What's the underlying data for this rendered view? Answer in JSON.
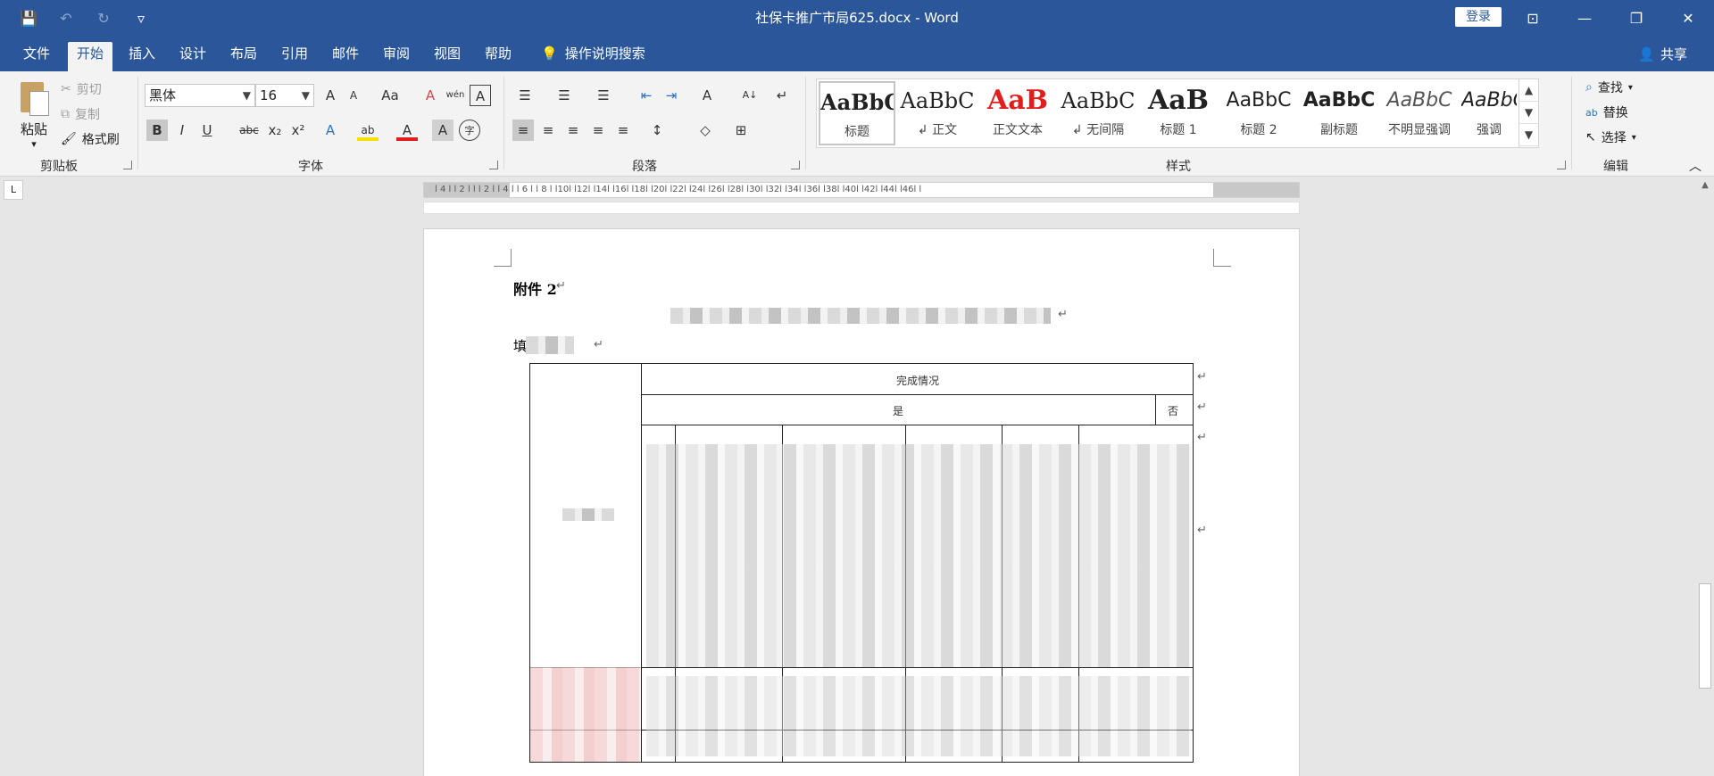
{
  "titlebar": {
    "title": "社保卡推广市局625.docx  -  Word",
    "login": "登录",
    "qat": {
      "save": "💾",
      "undo": "↶",
      "redo": "↻",
      "customize": "▿"
    },
    "win": {
      "ribbon_opts": "⊡",
      "minimize": "—",
      "restore": "❐",
      "close": "✕"
    }
  },
  "tabs": [
    {
      "label": "文件"
    },
    {
      "label": "开始"
    },
    {
      "label": "插入"
    },
    {
      "label": "设计"
    },
    {
      "label": "布局"
    },
    {
      "label": "引用"
    },
    {
      "label": "邮件"
    },
    {
      "label": "审阅"
    },
    {
      "label": "视图"
    },
    {
      "label": "帮助"
    }
  ],
  "tell_me": {
    "icon": "💡",
    "label": "操作说明搜索"
  },
  "share": {
    "icon": "👤",
    "label": "共享"
  },
  "clipboard": {
    "paste": "粘贴",
    "paste_arrow": "▾",
    "cut": "剪切",
    "copy": "复制",
    "format_painter": "格式刷",
    "group_label": "剪贴板"
  },
  "font": {
    "name": "黑体",
    "size": "16",
    "group_label": "字体",
    "grow": "A",
    "shrink": "A",
    "case": "Aa",
    "clear": "A",
    "phonetic": "wén",
    "border": "A",
    "bold": "B",
    "italic": "I",
    "underline": "U",
    "strike": "abc",
    "sub": "x₂",
    "sup": "x²",
    "effects": "A",
    "highlight": "ab",
    "color": "A",
    "shade": "A",
    "enclose": "字"
  },
  "paragraph": {
    "group_label": "段落",
    "bullets": "☰",
    "numbering": "☰",
    "multilevel": "☰",
    "decrease_indent": "⇤",
    "increase_indent": "⇥",
    "cjk": "A",
    "sort": "A↓",
    "show_marks": "↵",
    "align_left": "≡",
    "center": "≡",
    "align_right": "≡",
    "justify": "≡",
    "distributed": "≡",
    "line_spacing": "↕",
    "shading": "◇",
    "borders": "⊞"
  },
  "styles": {
    "group_label": "样式",
    "items": [
      {
        "preview": "AaBbC",
        "name": "标题"
      },
      {
        "preview": "AaBbC",
        "name": "↲ 正文"
      },
      {
        "preview": "AaB",
        "name": "正文文本"
      },
      {
        "preview": "AaBbC",
        "name": "↲ 无间隔"
      },
      {
        "preview": "AaB",
        "name": "标题 1"
      },
      {
        "preview": "AaBbC",
        "name": "标题 2"
      },
      {
        "preview": "AaBbC",
        "name": "副标题"
      },
      {
        "preview": "AaBbC",
        "name": "不明显强调"
      },
      {
        "preview": "AaBbC",
        "name": "强调"
      }
    ],
    "scroll_up": "▲",
    "scroll_down": "▼",
    "more": "▼"
  },
  "editing": {
    "group_label": "编辑",
    "find": "查找",
    "replace": "替换",
    "select": "选择"
  },
  "ribbon_collapse": "︿",
  "ruler": {
    "tab_selector": "L",
    "ticks": "l 4 l  l 2 l   l   l 2 l  l 4 l  l 6 l  l 8 l  l10l  l12l  l14l  l16l  l18l  l20l  l22l  l24l  l26l  l28l  l30l  l32l  l34l  l36l  l38l  l40l  l42l  l44l  l46l   l"
  },
  "document": {
    "attachment": "附件 2",
    "line_label": "填",
    "para_mark": "↵",
    "table": {
      "header_complete": "完成情况",
      "header_yes": "是",
      "header_no": "否",
      "cell_mark": "↵"
    }
  },
  "scrollbar": {
    "up": "▲",
    "down": "▼"
  }
}
